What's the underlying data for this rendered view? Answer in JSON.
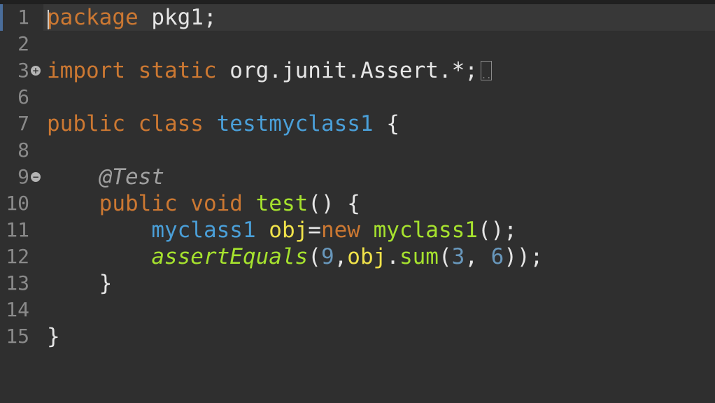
{
  "line_numbers": [
    "1",
    "2",
    "3",
    "6",
    "7",
    "8",
    "9",
    "10",
    "11",
    "12",
    "13",
    "14",
    "15"
  ],
  "fold_icons": {
    "line3": "+",
    "line9": "−"
  },
  "lines": {
    "l1": {
      "package_kw": "package",
      "pkg_name": " pkg1;"
    },
    "l3": {
      "import_kw": "import",
      "static_kw": " static",
      "path": " org.junit.Assert.*;",
      "collapsed": ".."
    },
    "l7": {
      "public_kw": "public",
      "class_kw": " class",
      "class_name": " testmyclass1",
      "brace": " {"
    },
    "l9": {
      "annotation": "@Test"
    },
    "l10": {
      "public_kw": "public",
      "void_kw": " void",
      "method_name": " test",
      "rest": "() {"
    },
    "l11": {
      "type": "myclass1",
      "space": " ",
      "var": "obj",
      "eq": "=",
      "new_kw": "new",
      "space2": " ",
      "ctor": "myclass1",
      "rest": "();"
    },
    "l12": {
      "assert": "assertEquals",
      "p1": "(",
      "n9": "9",
      "comma": ",",
      "obj": "obj",
      "dot": ".",
      "sum": "sum",
      "p2": "(",
      "n3": "3",
      "comma2": ", ",
      "n6": "6",
      "end": "));"
    },
    "l13": {
      "brace": "}"
    },
    "l15": {
      "brace": "}"
    }
  }
}
